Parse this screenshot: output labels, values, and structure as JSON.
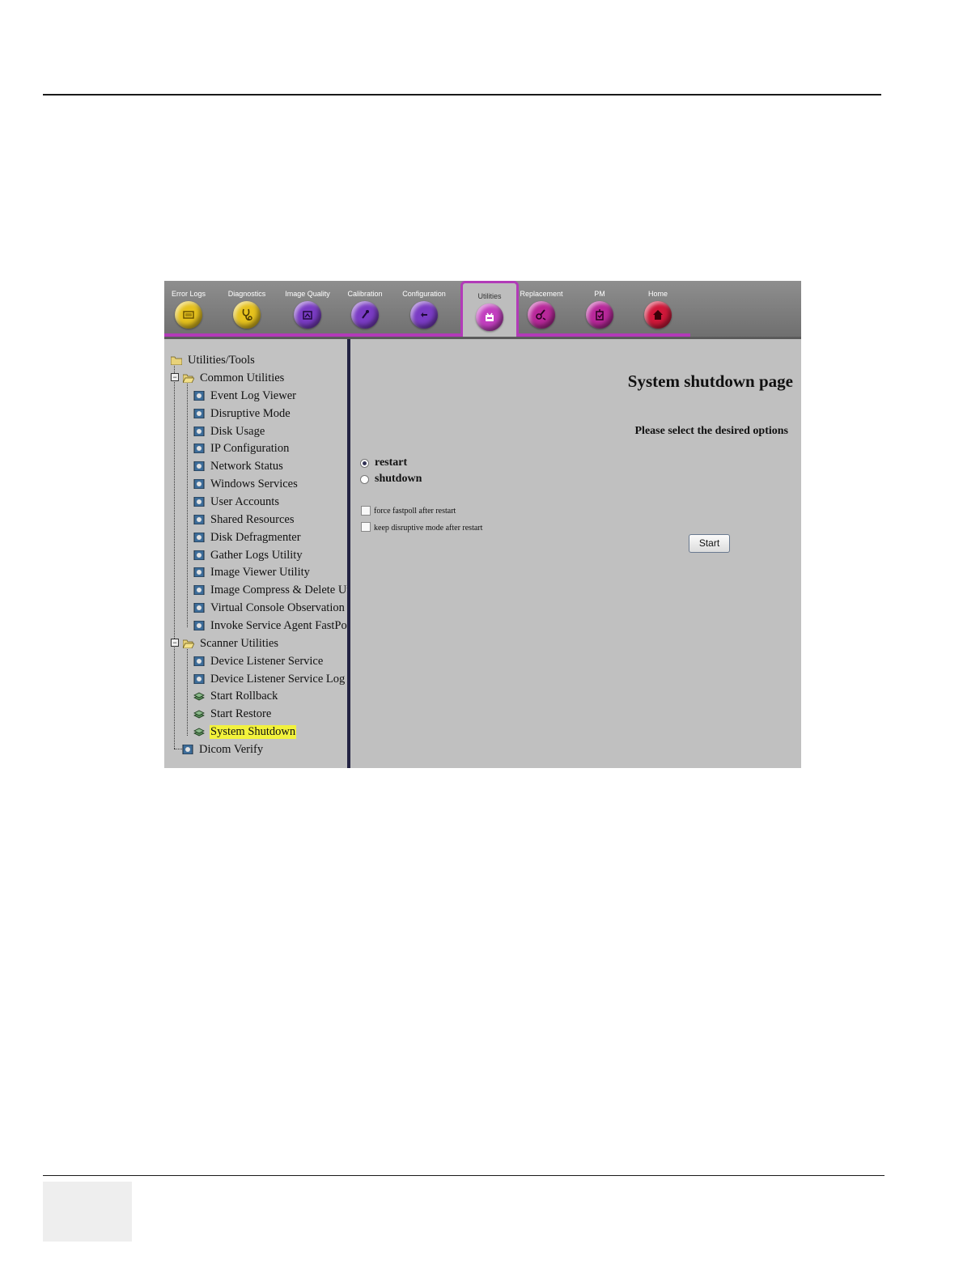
{
  "toolbar": {
    "tabs": [
      {
        "label": "Error Logs",
        "icon": "error-logs-icon",
        "color": "#e6c21e"
      },
      {
        "label": "Diagnostics",
        "icon": "stethoscope-icon",
        "color": "#e6c21e"
      },
      {
        "label": "Image Quality",
        "icon": "image-quality-icon",
        "color": "#7a3cc4"
      },
      {
        "label": "Calibration",
        "icon": "calibration-icon",
        "color": "#7a3cc4"
      },
      {
        "label": "Configuration",
        "icon": "configuration-icon",
        "color": "#7a3cc4"
      },
      {
        "label": "Utilities",
        "icon": "utilities-icon",
        "color": "#c23fbf",
        "active": true
      },
      {
        "label": "Replacement",
        "icon": "replacement-icon",
        "color": "#b8289a"
      },
      {
        "label": "PM",
        "icon": "pm-icon",
        "color": "#b8289a"
      },
      {
        "label": "Home",
        "icon": "home-icon",
        "color": "#d0183a"
      }
    ],
    "accent": "#b23ab8"
  },
  "tree": {
    "root": "Utilities/Tools",
    "common_utilities": {
      "label": "Common Utilities",
      "items": [
        "Event Log Viewer",
        "Disruptive Mode",
        "Disk Usage",
        "IP Configuration",
        "Network Status",
        "Windows Services",
        "User Accounts",
        "Shared Resources",
        "Disk Defragmenter",
        "Gather Logs Utility",
        "Image Viewer Utility",
        "Image Compress & Delete Util",
        "Virtual Console Observation",
        "Invoke Service Agent FastPoll"
      ]
    },
    "scanner_utilities": {
      "label": "Scanner Utilities",
      "items": [
        "Device Listener Service",
        "Device Listener Service Log",
        "Start Rollback",
        "Start Restore",
        "System Shutdown"
      ],
      "selected": "System Shutdown"
    },
    "dicom_verify": "Dicom Verify",
    "selection_color": "#f2f23c"
  },
  "content": {
    "title": "System shutdown page",
    "subtitle": "Please select the desired options",
    "radios": [
      {
        "label": "restart",
        "checked": true
      },
      {
        "label": "shutdown",
        "checked": false
      }
    ],
    "checkboxes": [
      {
        "label": "force fastpoll after restart",
        "checked": false
      },
      {
        "label": "keep disruptive mode after restart",
        "checked": false
      }
    ],
    "start_label": "Start"
  }
}
